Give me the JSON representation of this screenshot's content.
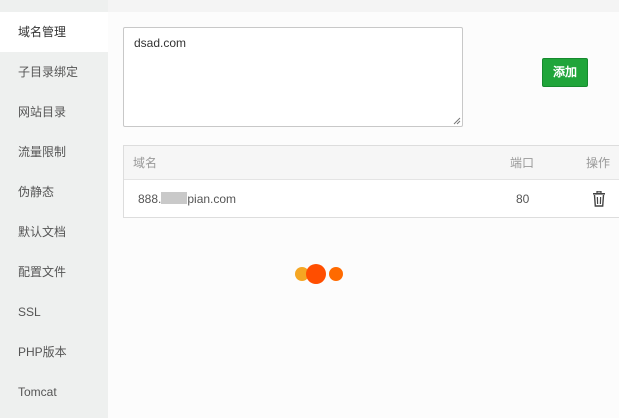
{
  "sidebar": {
    "items": [
      {
        "label": "域名管理",
        "active": true
      },
      {
        "label": "子目录绑定",
        "active": false
      },
      {
        "label": "网站目录",
        "active": false
      },
      {
        "label": "流量限制",
        "active": false
      },
      {
        "label": "伪静态",
        "active": false
      },
      {
        "label": "默认文档",
        "active": false
      },
      {
        "label": "配置文件",
        "active": false
      },
      {
        "label": "SSL",
        "active": false
      },
      {
        "label": "PHP版本",
        "active": false
      },
      {
        "label": "Tomcat",
        "active": false
      }
    ]
  },
  "domain_input": {
    "value": "dsad.com"
  },
  "add_button": {
    "label": "添加",
    "color": "#20a53a"
  },
  "table": {
    "headers": {
      "domain": "域名",
      "port": "端口",
      "action": "操作"
    },
    "rows": [
      {
        "domain_prefix": "888.",
        "domain_suffix": "pian.com",
        "port": "80",
        "action_icon": "trash-icon"
      }
    ]
  },
  "loader": {
    "colors": [
      "#f5a623",
      "#ff4e00",
      "#ff6a00"
    ]
  }
}
